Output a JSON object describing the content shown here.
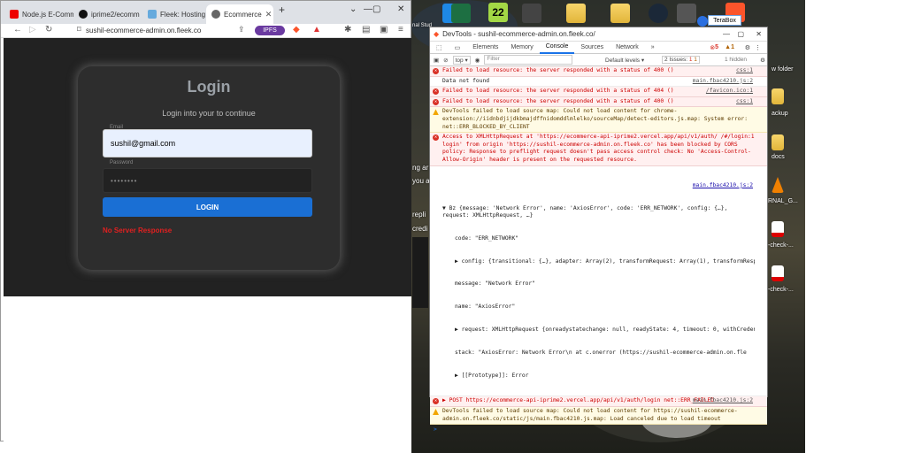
{
  "browser": {
    "tabs": [
      {
        "label": "Node.js E-Comm",
        "active": false
      },
      {
        "label": "iprime2/ecomm",
        "active": false
      },
      {
        "label": "Fleek: Hosting",
        "active": false
      },
      {
        "label": "Ecommerce",
        "active": true
      }
    ],
    "url": "sushil-ecommerce-admin.on.fleek.co",
    "ipfs_label": "IPFS"
  },
  "login": {
    "title": "Login",
    "subtitle": "Login into your to continue",
    "email_label": "Email",
    "email_value": "sushil@gmail.com",
    "password_label": "Password",
    "password_value": "••••••••",
    "button": "LOGIN",
    "error": "No Server Response"
  },
  "desktop": {
    "labels": [
      "TeraBox",
      "w folder",
      "ackup",
      "docs",
      "RNAL_G...",
      "-check-...",
      "-check-..."
    ],
    "badge": "22",
    "partial_texts": [
      "ng ar",
      "you a",
      "repli",
      "credi",
      "nal Stud"
    ]
  },
  "devtools": {
    "title": "DevTools - sushil-ecommerce-admin.on.fleek.co/",
    "tabs": [
      "Elements",
      "Memory",
      "Console",
      "Sources",
      "Network"
    ],
    "error_count": "5",
    "warn_count": "1",
    "context": "top",
    "filter_placeholder": "Filter",
    "levels": "Default levels",
    "issues": "2 Issues:",
    "issues_err": "1",
    "issues_warn": "1",
    "hidden": "1 hidden",
    "logs": [
      {
        "type": "err",
        "text": "Failed to load resource: the server responded with a status of 400 ()",
        "src": "css:1"
      },
      {
        "type": "info",
        "text": "Data not found",
        "src": "main.fbac4210.js:2"
      },
      {
        "type": "err",
        "text": "Failed to load resource: the server responded with a status of 404 ()",
        "src": "/favicon.ico:1"
      },
      {
        "type": "err",
        "text": "Failed to load resource: the server responded with a status of 400 ()",
        "src": "css:1"
      },
      {
        "type": "warn",
        "text": "DevTools failed to load source map: Could not load content for chrome-extension://iidnbdjijdkbmajdffnidomddlmlelko/sourceMap/detect-editors.js.map: System error: net::ERR_BLOCKED_BY_CLIENT",
        "src": ""
      },
      {
        "type": "err",
        "text": "Access to XMLHttpRequest at 'https://ecommerce-api-iprime2.vercel.app/api/v1/auth/ /#/login:1 login' from origin 'https://sushil-ecommerce-admin.on.fleek.co' has been blocked by CORS policy: Response to preflight request doesn't pass access control check: No 'Access-Control-Allow-Origin' header is present on the requested resource.",
        "src": ""
      }
    ],
    "error_obj": {
      "src": "main.fbac4210.js:2",
      "head": "▼ Bz {message: 'Network Error', name: 'AxiosError', code: 'ERR_NETWORK', config: {…}, request: XMLHttpRequest, …}",
      "lines": [
        "code: \"ERR_NETWORK\"",
        "▶ config: {transitional: {…}, adapter: Array(2), transformRequest: Array(1), transformRespon",
        "message: \"Network Error\"",
        "name: \"AxiosError\"",
        "▶ request: XMLHttpRequest {onreadystatechange: null, readyState: 4, timeout: 0, withCredenti",
        "stack: \"AxiosError: Network Error\\n    at c.onerror (https://sushil-ecommerce-admin.on.fle",
        "▶ [[Prototype]]: Error"
      ]
    },
    "post_log": {
      "text": "▶ POST https://ecommerce-api-iprime2.vercel.app/api/v1/auth/login net::ERR_FAILED",
      "src": "main.fbac4210.js:2"
    },
    "last_warn": "DevTools failed to load source map: Could not load content for https://sushil-ecommerce-admin.on.fleek.co/static/js/main.fbac4210.js.map: Load canceled due to load timeout",
    "prompt": ">"
  }
}
